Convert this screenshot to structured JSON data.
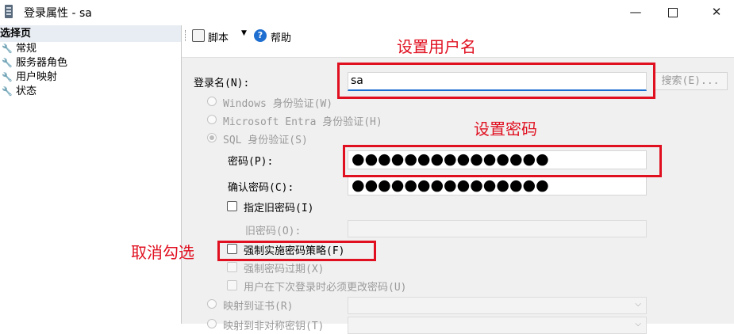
{
  "window": {
    "title": "登录属性 - sa",
    "minimize": "—",
    "close": "✕"
  },
  "left_pane": {
    "header": "选择页",
    "items": [
      {
        "label": "常规"
      },
      {
        "label": "服务器角色"
      },
      {
        "label": "用户映射"
      },
      {
        "label": "状态"
      }
    ]
  },
  "toolbar": {
    "script_label": "脚本",
    "dropdown_caret": "▼",
    "help_glyph": "?",
    "help_label": "帮助"
  },
  "form": {
    "login_name_label": "登录名(N):",
    "login_name_value": "sa",
    "search_button": "搜索(E)...",
    "windows_auth": "Windows 身份验证(W)",
    "entra_auth": "Microsoft Entra 身份验证(H)",
    "sql_auth": "SQL 身份验证(S)",
    "password_label": "密码(P):",
    "password_value": "●●●●●●●●●●●●●●●",
    "confirm_password_label": "确认密码(C):",
    "confirm_password_value": "●●●●●●●●●●●●●●●",
    "specify_old_password": "指定旧密码(I)",
    "old_password_label": "旧密码(O):",
    "enforce_policy": "强制实施密码策略(F)",
    "enforce_expiration": "强制密码过期(X)",
    "must_change": "用户在下次登录时必须更改密码(U)",
    "map_certificate": "映射到证书(R)",
    "map_asym_key": "映射到非对称密钥(T)",
    "select_caret": "⌵"
  },
  "annotations": {
    "set_username": "设置用户名",
    "set_password": "设置密码",
    "uncheck": "取消勾选",
    "color": "#e01020"
  },
  "colors": {
    "accent": "#1a6fd3",
    "annotation": "#e01020"
  }
}
